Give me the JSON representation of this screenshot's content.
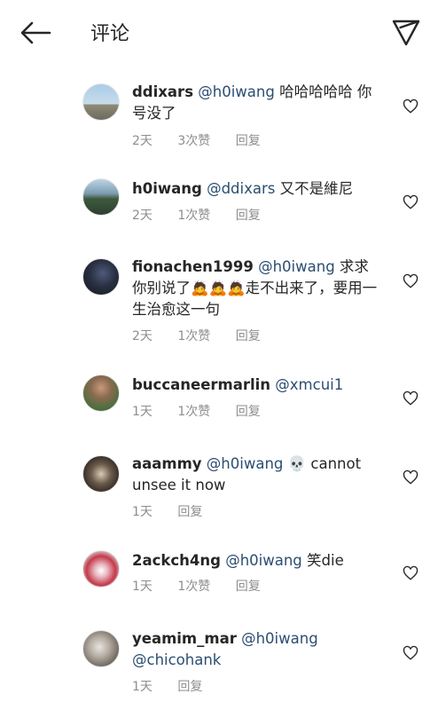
{
  "header": {
    "title": "评论"
  },
  "comments": [
    {
      "username": "ddixars",
      "mention": "@h0iwang",
      "text": " 哈哈哈哈哈 你号没了",
      "time": "2天",
      "likes": "3次赞",
      "reply": "回复"
    },
    {
      "username": "h0iwang",
      "mention": "@ddixars",
      "text": " 又不是維尼",
      "time": "2天",
      "likes": "1次赞",
      "reply": "回复"
    },
    {
      "username": "fionachen1999",
      "mention": "@h0iwang",
      "text": " 求求你别说了🙇🙇🙇走不出来了，要用一生治愈这一句",
      "time": "2天",
      "likes": "1次赞",
      "reply": "回复"
    },
    {
      "username": "buccaneermarlin",
      "mention": "@xmcui1",
      "text": "",
      "time": "1天",
      "likes": "1次赞",
      "reply": "回复"
    },
    {
      "username": "aaammy",
      "mention": "@h0iwang",
      "text": " 💀 cannot unsee it now",
      "time": "1天",
      "likes": "",
      "reply": "回复"
    },
    {
      "username": "2ackch4ng",
      "mention": "@h0iwang",
      "text": " 笑die",
      "time": "1天",
      "likes": "1次赞",
      "reply": "回复"
    },
    {
      "username": "yeamim_mar",
      "mention": "@h0iwang @chicohank",
      "text": "",
      "time": "1天",
      "likes": "",
      "reply": "回复"
    }
  ]
}
